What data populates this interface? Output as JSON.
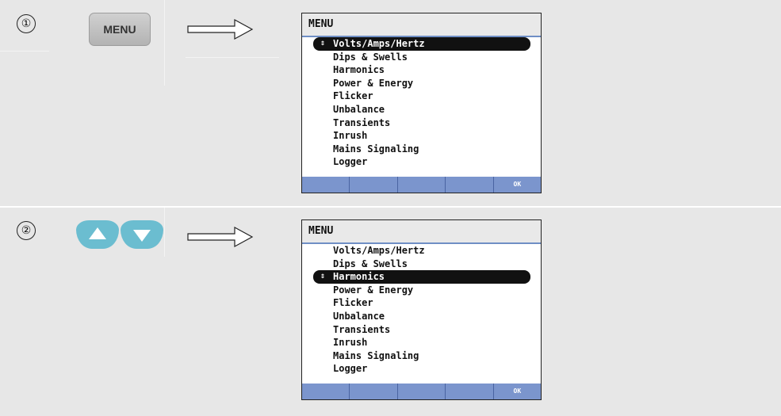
{
  "steps": [
    {
      "number": "①",
      "key_label": "MENU",
      "screen": {
        "title": "MENU",
        "items": [
          "Volts/Amps/Hertz",
          "Dips & Swells",
          "Harmonics",
          "Power & Energy",
          "Flicker",
          "Unbalance",
          "Transients",
          "Inrush",
          "Mains Signaling",
          "Logger"
        ],
        "selected_index": 0,
        "softkeys": [
          "",
          "",
          "",
          "",
          "OK"
        ]
      }
    },
    {
      "number": "②",
      "keys": [
        "up-arrow-icon",
        "down-arrow-icon"
      ],
      "screen": {
        "title": "MENU",
        "items": [
          "Volts/Amps/Hertz",
          "Dips & Swells",
          "Harmonics",
          "Power & Energy",
          "Flicker",
          "Unbalance",
          "Transients",
          "Inrush",
          "Mains Signaling",
          "Logger"
        ],
        "selected_index": 2,
        "softkeys": [
          "",
          "",
          "",
          "",
          "OK"
        ]
      }
    }
  ],
  "colors": {
    "row_background": "#e7e7e7",
    "arrow_key": "#6bbdd0",
    "softkey_bar": "#7b95cd",
    "selection": "#111111"
  }
}
